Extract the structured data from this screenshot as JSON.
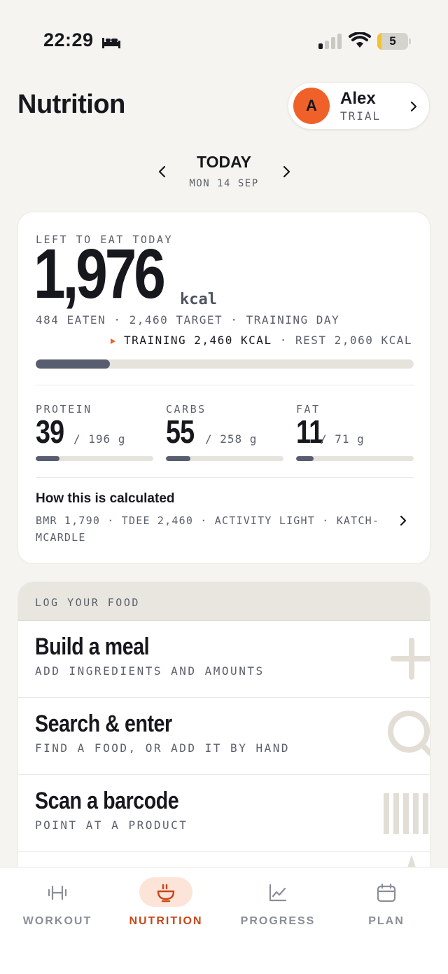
{
  "status_bar": {
    "time": "22:29",
    "battery": "5"
  },
  "header": {
    "title": "Nutrition",
    "profile": {
      "initial": "A",
      "name": "Alex",
      "status": "TRIAL"
    }
  },
  "date_nav": {
    "title": "TODAY",
    "subtitle": "MON 14 SEP"
  },
  "summary": {
    "label": "LEFT TO EAT TODAY",
    "value": "1,976",
    "unit": "kcal",
    "eaten_line": "484 EATEN · 2,460 TARGET · TRAINING DAY",
    "training": "TRAINING 2,460 KCAL",
    "separator": "·",
    "rest": "REST 2,060 KCAL",
    "progress_fraction": 0.197,
    "macros": [
      {
        "label": "PROTEIN",
        "value": "39",
        "target": "/ 196 g",
        "fraction": 0.2
      },
      {
        "label": "CARBS",
        "value": "55",
        "target": "/ 258 g",
        "fraction": 0.21
      },
      {
        "label": "FAT",
        "value": "11",
        "target": "/ 71 g",
        "fraction": 0.15
      }
    ],
    "calc_title": "How this is calculated",
    "calc_detail": "BMR 1,790 · TDEE 2,460 · ACTIVITY LIGHT · KATCH-MCARDLE"
  },
  "log": {
    "header": "LOG YOUR FOOD",
    "items": [
      {
        "title": "Build a meal",
        "subtitle": "ADD INGREDIENTS AND AMOUNTS",
        "icon": "plus-icon"
      },
      {
        "title": "Search & enter",
        "subtitle": "FIND A FOOD, OR ADD IT BY HAND",
        "icon": "search-icon"
      },
      {
        "title": "Scan a barcode",
        "subtitle": "POINT AT A PRODUCT",
        "icon": "barcode-icon"
      }
    ]
  },
  "tabs": [
    {
      "label": "WORKOUT",
      "icon": "dumbbell-icon",
      "active": false
    },
    {
      "label": "NUTRITION",
      "icon": "bowl-icon",
      "active": true
    },
    {
      "label": "PROGRESS",
      "icon": "chart-icon",
      "active": false
    },
    {
      "label": "PLAN",
      "icon": "calendar-icon",
      "active": false
    }
  ],
  "colors": {
    "accent": "#f0612a",
    "accent_text": "#c8461a",
    "bar_fill": "#585e6f",
    "bar_track": "#e5e3dc",
    "background": "#f5f4f0"
  }
}
